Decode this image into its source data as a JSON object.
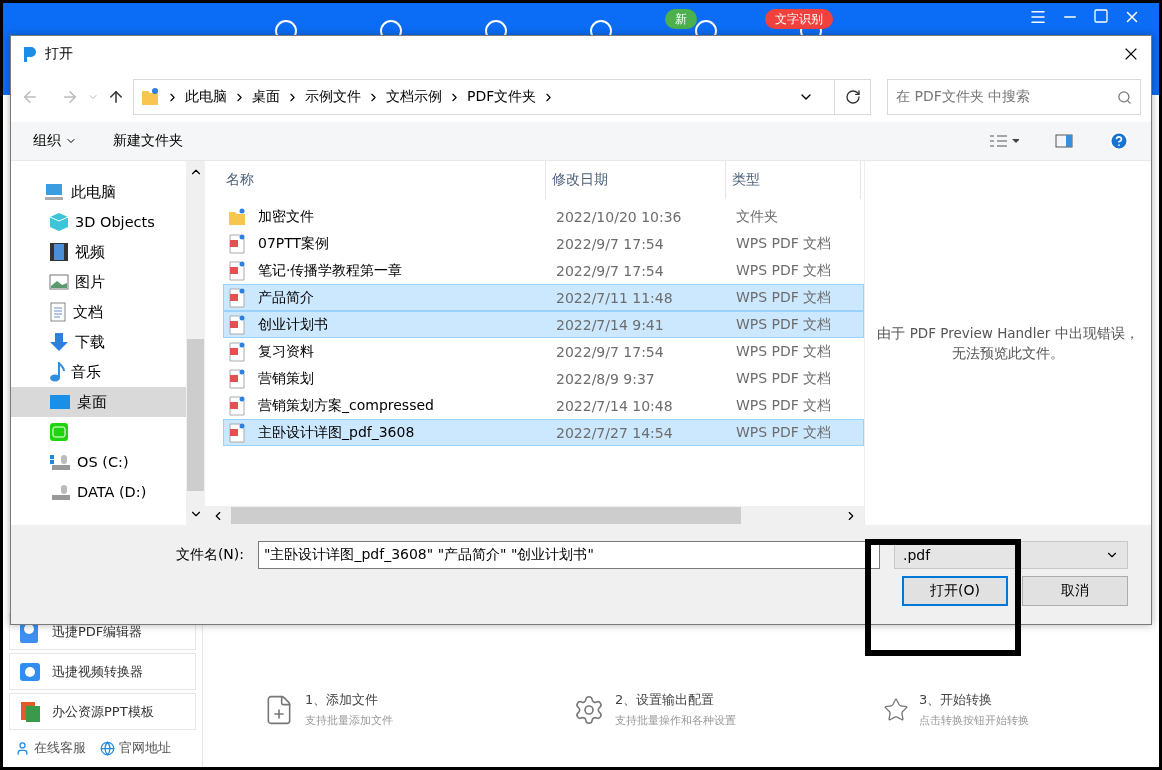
{
  "app": {
    "badges": [
      {
        "label": "新",
        "color": "#4cb04c"
      },
      {
        "label": "文字识别",
        "color": "#f0413c"
      }
    ],
    "sidebar": [
      {
        "label": "迅捷PDF编辑器",
        "kind": "pdf"
      },
      {
        "label": "迅捷视频转换器",
        "kind": "video"
      },
      {
        "label": "办公资源PPT模板",
        "kind": "ppt"
      }
    ],
    "links": [
      {
        "label": "在线客服",
        "kind": "service"
      },
      {
        "label": "官网地址",
        "kind": "web"
      }
    ],
    "steps": [
      {
        "title": "1、添加文件",
        "hint": "支持批量添加文件",
        "kind": "add"
      },
      {
        "title": "2、设置输出配置",
        "hint": "支持批量操作和各种设置",
        "kind": "settings"
      },
      {
        "title": "3、开始转换",
        "hint": "点击转换按钮开始转换",
        "kind": "convert"
      }
    ]
  },
  "dialog": {
    "title": "打开",
    "breadcrumb": [
      "此电脑",
      "桌面",
      "示例文件",
      "文档示例",
      "PDF文件夹"
    ],
    "search": {
      "placeholder": "在 PDF文件夹 中搜索"
    },
    "toolbar": {
      "organize": "组织",
      "new_folder": "新建文件夹"
    },
    "nav": [
      {
        "label": "此电脑",
        "kind": "pc",
        "selected": false,
        "children": [
          {
            "label": "3D Objects",
            "kind": "cube",
            "selected": false
          },
          {
            "label": "视频",
            "kind": "video",
            "selected": false
          },
          {
            "label": "图片",
            "kind": "picture",
            "selected": false
          },
          {
            "label": "文档",
            "kind": "docs",
            "selected": false
          },
          {
            "label": "下载",
            "kind": "download",
            "selected": false
          },
          {
            "label": "音乐",
            "kind": "music",
            "selected": false
          },
          {
            "label": "桌面",
            "kind": "desktop",
            "selected": true
          },
          {
            "kind": "app",
            "selected": false
          },
          {
            "label": "OS (C:)",
            "kind": "drive_c",
            "selected": false
          },
          {
            "label": "DATA (D:)",
            "kind": "drive",
            "selected": false
          }
        ]
      }
    ],
    "columns": [
      "名称",
      "修改日期",
      "类型"
    ],
    "files": [
      {
        "name": "加密文件",
        "date": "2022/10/20 10:36",
        "type": "文件夹",
        "kind": "folder",
        "selected": false
      },
      {
        "name": "07PTT案例",
        "date": "2022/9/7 17:54",
        "type": "WPS PDF 文档",
        "kind": "pdf",
        "selected": false
      },
      {
        "name": "笔记·传播学教程第一章",
        "date": "2022/9/7 17:54",
        "type": "WPS PDF 文档",
        "kind": "pdf",
        "selected": false
      },
      {
        "name": "产品简介",
        "date": "2022/7/11 11:48",
        "type": "WPS PDF 文档",
        "kind": "pdf",
        "selected": true
      },
      {
        "name": "创业计划书",
        "date": "2022/7/14 9:41",
        "type": "WPS PDF 文档",
        "kind": "pdf",
        "selected": true
      },
      {
        "name": "复习资料",
        "date": "2022/9/7 17:54",
        "type": "WPS PDF 文档",
        "kind": "pdf",
        "selected": false
      },
      {
        "name": "营销策划",
        "date": "2022/8/9 9:37",
        "type": "WPS PDF 文档",
        "kind": "pdf",
        "selected": false
      },
      {
        "name": "营销策划方案_compressed",
        "date": "2022/7/14 10:48",
        "type": "WPS PDF 文档",
        "kind": "pdf",
        "selected": false
      },
      {
        "name": "主卧设计详图_pdf_3608",
        "date": "2022/7/27 14:54",
        "type": "WPS PDF 文档",
        "kind": "pdf",
        "selected": true
      }
    ],
    "preview_message": [
      "由于 PDF Preview Handler 中出现错误，",
      "无法预览此文件。"
    ],
    "filename": {
      "label": "文件名(N):",
      "value": "\"主卧设计详图_pdf_3608\" \"产品简介\" \"创业计划书\""
    },
    "filetype": {
      "value": ".pdf"
    },
    "buttons": [
      {
        "label": "打开(O)",
        "kind": "primary"
      },
      {
        "label": "取消",
        "kind": "normal"
      }
    ]
  },
  "annotation": {
    "kind": "frame"
  }
}
